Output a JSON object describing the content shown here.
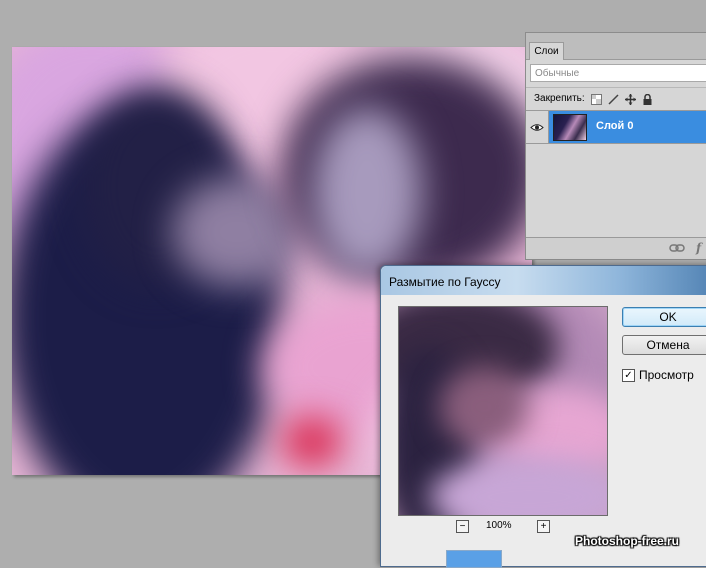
{
  "layers_panel": {
    "tab_label": "Слои",
    "blend_mode": "Обычные",
    "lock_label": "Закрепить:",
    "layer_name": "Слой 0"
  },
  "gaussian_dialog": {
    "title": "Размытие по Гауссу",
    "ok_label": "OK",
    "cancel_label": "Отмена",
    "preview_label": "Просмотр",
    "preview_checked": true,
    "zoom_out_label": "−",
    "zoom_in_label": "+",
    "zoom_value": "100%"
  },
  "watermark": "Photoshop-free.ru",
  "colors": {
    "selected_layer": "#3a8de0",
    "canvas_bg": "#aeaeae"
  }
}
